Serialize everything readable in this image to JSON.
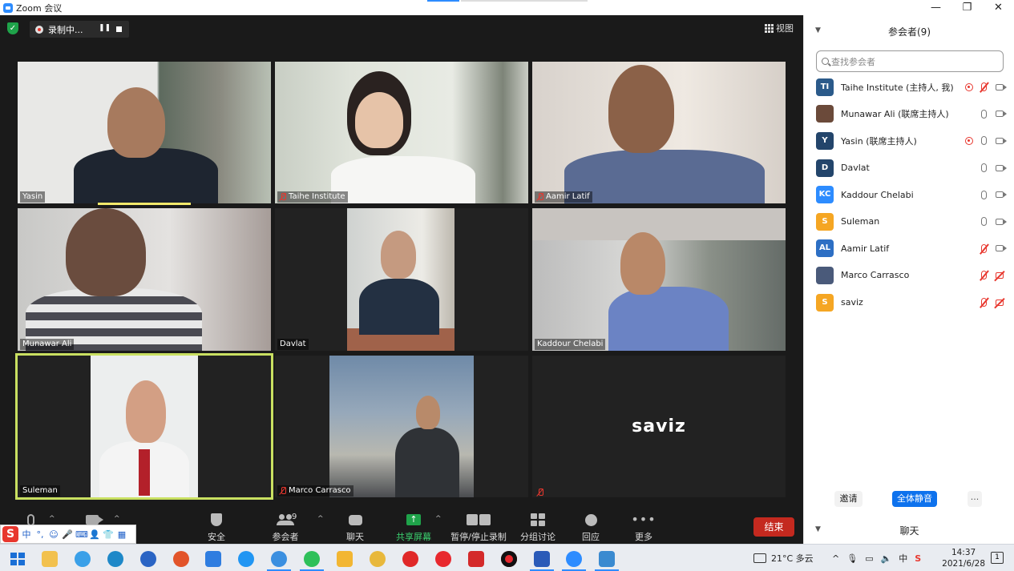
{
  "window": {
    "title": "Zoom 会议",
    "controls": [
      "—",
      "❐",
      "✕"
    ]
  },
  "meeting": {
    "recording_label": "录制中...",
    "view_label": "视图",
    "tiles": [
      {
        "name": "Yasin",
        "muted": false,
        "speaking": true
      },
      {
        "name": "Taihe Institute",
        "muted": true
      },
      {
        "name": "Aamir Latif",
        "muted": true
      },
      {
        "name": "Munawar Ali",
        "muted": false
      },
      {
        "name": "Davlat",
        "muted": false
      },
      {
        "name": "Kaddour Chelabi",
        "muted": false
      },
      {
        "name": "Suleman",
        "muted": false,
        "active": true
      },
      {
        "name": "Marco Carrasco",
        "muted": true
      },
      {
        "name": "",
        "muted": true,
        "avatar_text": "saviz"
      }
    ]
  },
  "toolbar": {
    "security": "安全",
    "participants": "参会者",
    "participants_count": "9",
    "chat": "聊天",
    "share": "共享屏幕",
    "record": "暂停/停止录制",
    "breakout": "分组讨论",
    "reactions": "回应",
    "more": "更多",
    "end": "结束"
  },
  "ime": {
    "items": [
      "中",
      "°,",
      "☺",
      "🎤",
      "⌨",
      "👤",
      "👕",
      "▦"
    ]
  },
  "panel": {
    "title": "参会者(9)",
    "search_placeholder": "查找参会者",
    "participants": [
      {
        "initials": "TI",
        "name": "Taihe Institute (主持人, 我)",
        "color": "#2b5a8a",
        "rec": true,
        "mic": "off",
        "cam": "on"
      },
      {
        "initials": "",
        "name": "Munawar Ali (联席主持人)",
        "color": "#6b4a3a",
        "rec": false,
        "mic": "on",
        "cam": "on"
      },
      {
        "initials": "Y",
        "name": "Yasin (联席主持人)",
        "color": "#23456b",
        "rec": true,
        "mic": "on",
        "cam": "on"
      },
      {
        "initials": "D",
        "name": "Davlat",
        "color": "#23456b",
        "rec": false,
        "mic": "on",
        "cam": "on"
      },
      {
        "initials": "KC",
        "name": "Kaddour Chelabi",
        "color": "#2d8cff",
        "rec": false,
        "mic": "on",
        "cam": "on"
      },
      {
        "initials": "S",
        "name": "Suleman",
        "color": "#f5a623",
        "rec": false,
        "mic": "on",
        "cam": "on"
      },
      {
        "initials": "AL",
        "name": "Aamir Latif",
        "color": "#2d6fc4",
        "rec": false,
        "mic": "off",
        "cam": "on"
      },
      {
        "initials": "",
        "name": "Marco Carrasco",
        "color": "#4a5a7a",
        "rec": false,
        "mic": "off",
        "cam": "off"
      },
      {
        "initials": "S",
        "name": "saviz",
        "color": "#f5a623",
        "rec": false,
        "mic": "off",
        "cam": "off"
      }
    ],
    "invite": "邀请",
    "mute_all": "全体静音",
    "more": "...",
    "chat_title": "聊天"
  },
  "taskbar": {
    "weather": "21°C 多云",
    "time": "14:37",
    "date": "2021/6/28",
    "notifications": "1",
    "ime_label": "中"
  }
}
